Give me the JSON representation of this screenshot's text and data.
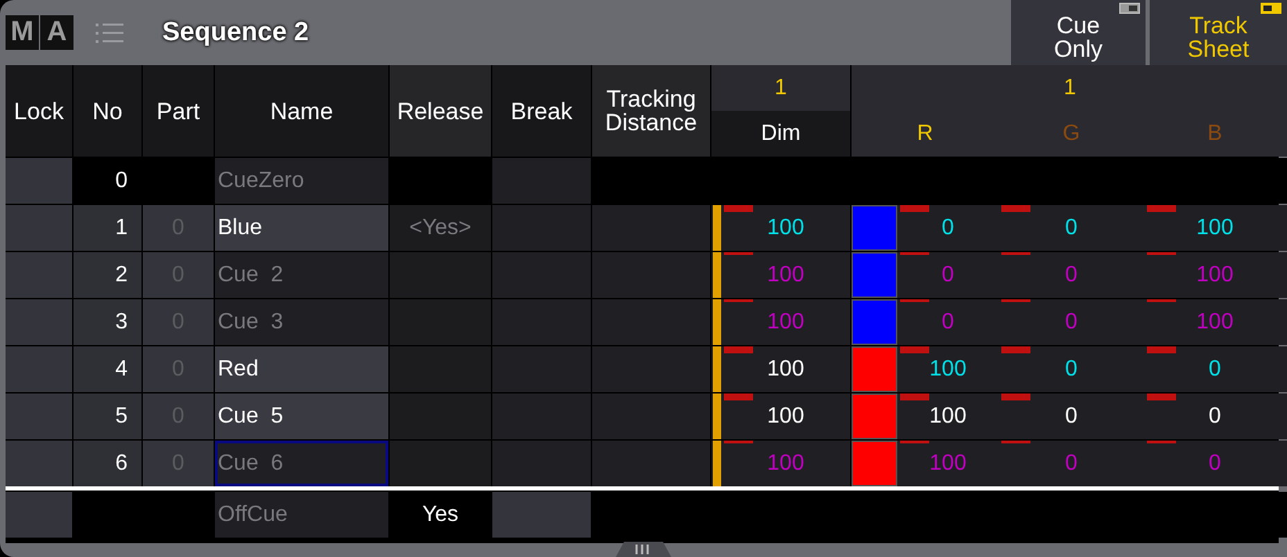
{
  "window": {
    "logo": [
      "M",
      "A"
    ],
    "title": "Sequence 2"
  },
  "toggles": [
    {
      "label": "Cue Only",
      "on": false
    },
    {
      "label": "Track Sheet",
      "on": true
    }
  ],
  "columns": [
    "Lock",
    "No",
    "Part",
    "Name",
    "Release",
    "Break",
    "Tracking Distance"
  ],
  "dim_group": {
    "number": "1",
    "label": "Dim"
  },
  "rgb_group": {
    "number": "1",
    "attributes": [
      {
        "label": "R",
        "selected": true
      },
      {
        "label": "G",
        "selected": false
      },
      {
        "label": "B",
        "selected": false
      }
    ]
  },
  "rows": [
    {
      "kind": "zero",
      "no": "0",
      "name": "CueZero"
    },
    {
      "kind": "cue",
      "no": "1",
      "part": "0",
      "name": "Blue",
      "named": true,
      "selected": false,
      "release": "<Yes>",
      "hard": true,
      "dim": {
        "text": "100",
        "color": "#00e0e8",
        "level": 1
      },
      "color": "#0000ff",
      "rgb": [
        {
          "text": "0",
          "color": "#00e0e8"
        },
        {
          "text": "0",
          "color": "#00e0e8"
        },
        {
          "text": "100",
          "color": "#00e0e8"
        }
      ]
    },
    {
      "kind": "cue",
      "no": "2",
      "part": "0",
      "name": "Cue  2",
      "named": false,
      "selected": false,
      "hard": false,
      "dim": {
        "text": "100",
        "color": "#c000c0",
        "level": 1
      },
      "color": "#0000ff",
      "rgb": [
        {
          "text": "0",
          "color": "#c000c0"
        },
        {
          "text": "0",
          "color": "#c000c0"
        },
        {
          "text": "100",
          "color": "#c000c0"
        }
      ]
    },
    {
      "kind": "cue",
      "no": "3",
      "part": "0",
      "name": "Cue  3",
      "named": false,
      "selected": false,
      "hard": false,
      "dim": {
        "text": "100",
        "color": "#c000c0",
        "level": 1
      },
      "color": "#0000ff",
      "rgb": [
        {
          "text": "0",
          "color": "#c000c0"
        },
        {
          "text": "0",
          "color": "#c000c0"
        },
        {
          "text": "100",
          "color": "#c000c0"
        }
      ]
    },
    {
      "kind": "cue",
      "no": "4",
      "part": "0",
      "name": "Red",
      "named": true,
      "selected": false,
      "hard": true,
      "dim": {
        "text": "100",
        "color": "#ffffff",
        "level": 1
      },
      "color": "#ff0000",
      "rgb": [
        {
          "text": "100",
          "color": "#00e0e8"
        },
        {
          "text": "0",
          "color": "#00e0e8"
        },
        {
          "text": "0",
          "color": "#00e0e8"
        }
      ]
    },
    {
      "kind": "cue",
      "no": "5",
      "part": "0",
      "name": "Cue  5",
      "named": true,
      "selected": false,
      "hard": true,
      "dim": {
        "text": "100",
        "color": "#ffffff",
        "level": 1
      },
      "color": "#ff0000",
      "rgb": [
        {
          "text": "100",
          "color": "#ffffff"
        },
        {
          "text": "0",
          "color": "#ffffff"
        },
        {
          "text": "0",
          "color": "#ffffff"
        }
      ]
    },
    {
      "kind": "cue",
      "no": "6",
      "part": "0",
      "name": "Cue  6",
      "named": false,
      "selected": true,
      "hard": false,
      "dim": {
        "text": "100",
        "color": "#c000c0",
        "level": 1
      },
      "color": "#ff0000",
      "rgb": [
        {
          "text": "100",
          "color": "#c000c0"
        },
        {
          "text": "0",
          "color": "#c000c0"
        },
        {
          "text": "0",
          "color": "#c000c0"
        }
      ]
    },
    {
      "kind": "off",
      "name": "OffCue",
      "release": "Yes"
    }
  ]
}
